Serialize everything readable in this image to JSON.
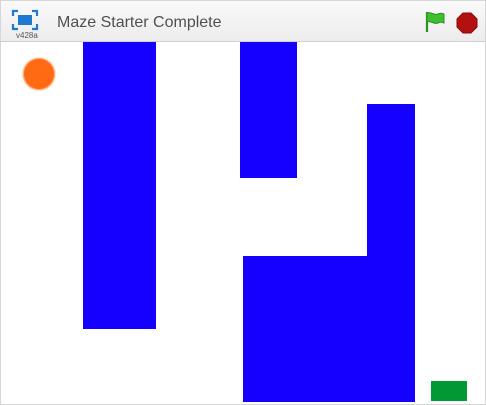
{
  "window": {
    "title": "Maze Starter Complete",
    "version": "v428a"
  },
  "icons": {
    "fullscreen": "fullscreen-icon",
    "green_flag": "green-flag-icon",
    "stop": "stop-sign-icon"
  },
  "colors": {
    "wall": "#1500ff",
    "goal": "#009933",
    "player_sprite": "#ff6a13",
    "flag": "#3dbf2f",
    "stop": "#b3110f",
    "accent_blue": "#1d7ad1"
  }
}
